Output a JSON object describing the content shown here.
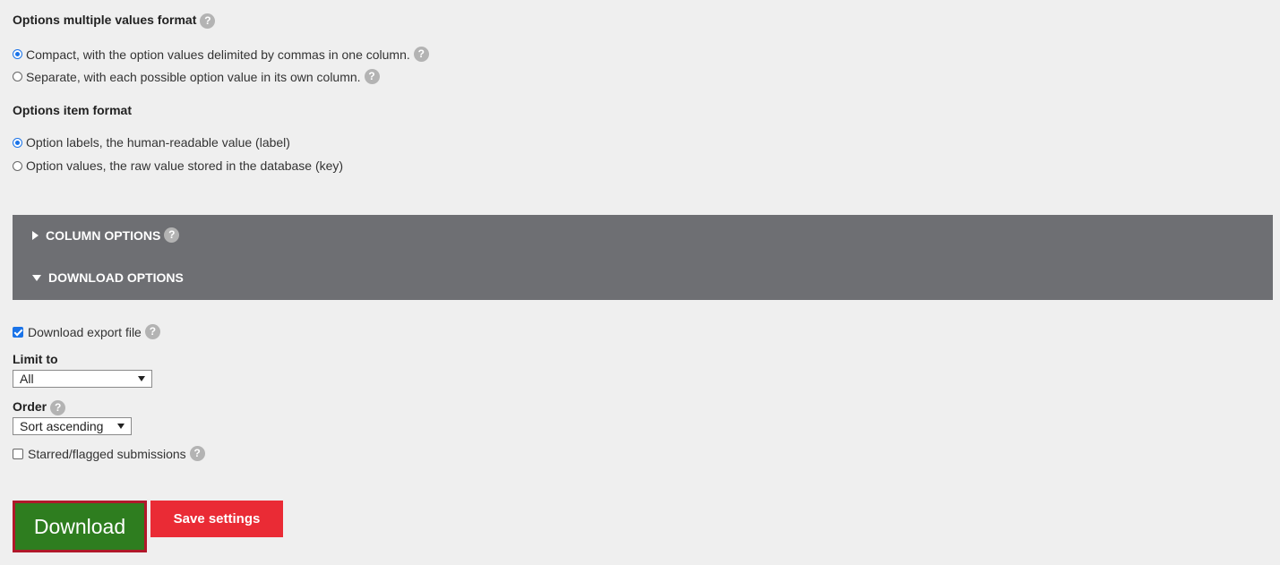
{
  "options_multiple_values": {
    "heading": "Options multiple values format",
    "choices": [
      {
        "label": "Compact, with the option values delimited by commas in one column.",
        "selected": true
      },
      {
        "label": "Separate, with each possible option value in its own column.",
        "selected": false
      }
    ]
  },
  "options_item_format": {
    "heading": "Options item format",
    "choices": [
      {
        "label": "Option labels, the human-readable value (label)",
        "selected": true
      },
      {
        "label": "Option values, the raw value stored in the database (key)",
        "selected": false
      }
    ]
  },
  "sections": {
    "column_options": "COLUMN OPTIONS",
    "download_options": "DOWNLOAD OPTIONS"
  },
  "download": {
    "export_file_label": "Download export file",
    "export_file_checked": true,
    "limit_label": "Limit to",
    "limit_value": "All",
    "order_label": "Order",
    "order_value": "Sort ascending",
    "starred_label": "Starred/flagged submissions",
    "starred_checked": false
  },
  "buttons": {
    "download": "Download",
    "save": "Save settings"
  },
  "help_glyph": "?",
  "colors": {
    "section_bar": "#6e6f73",
    "download_button": "#2e7d1f",
    "download_border": "#b0182a",
    "save_button": "#ea2b35"
  }
}
